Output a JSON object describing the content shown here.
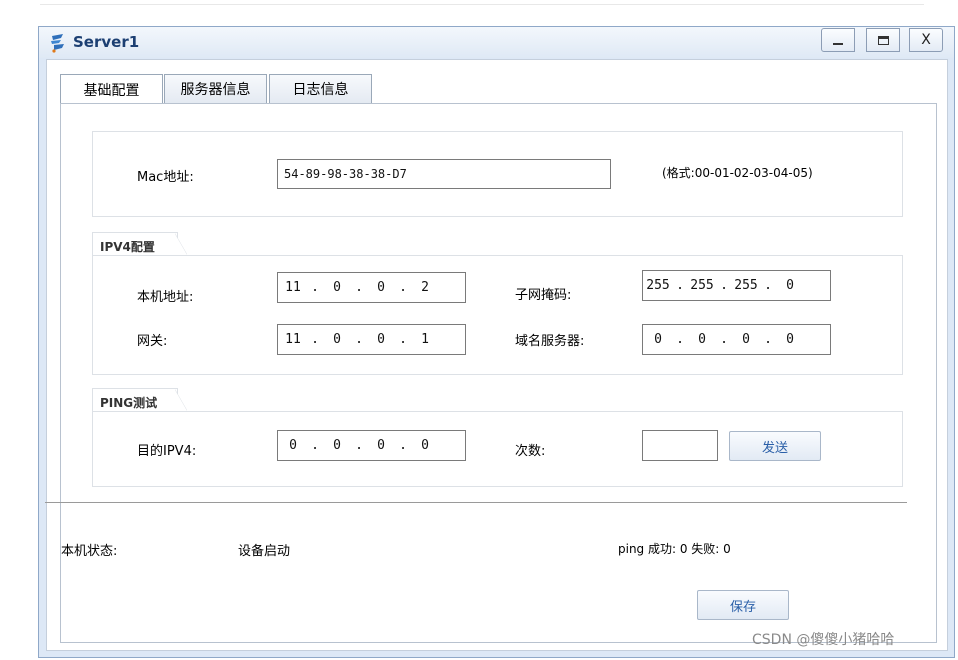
{
  "window": {
    "title": "Server1",
    "minimize_label": "_",
    "maximize_label": "",
    "close_label": "X"
  },
  "tabs": [
    {
      "label": "基础配置",
      "active": true
    },
    {
      "label": "服务器信息",
      "active": false
    },
    {
      "label": "日志信息",
      "active": false
    }
  ],
  "mac": {
    "label": "Mac地址:",
    "value": "54-89-98-38-38-D7",
    "hint": "(格式:00-01-02-03-04-05)"
  },
  "ipv4": {
    "group_title": "IPV4配置",
    "local_address_label": "本机地址:",
    "local_address": [
      "11",
      "0",
      "0",
      "2"
    ],
    "subnet_mask_label": "子网掩码:",
    "subnet_mask": [
      "255",
      "255",
      "255",
      "0"
    ],
    "gateway_label": "网关:",
    "gateway": [
      "11",
      "0",
      "0",
      "1"
    ],
    "dns_label": "域名服务器:",
    "dns": [
      "0",
      "0",
      "0",
      "0"
    ]
  },
  "ping": {
    "group_title": "PING测试",
    "dest_label": "目的IPV4:",
    "dest": [
      "0",
      "0",
      "0",
      "0"
    ],
    "count_label": "次数:",
    "count_value": "",
    "send_label": "发送"
  },
  "status": {
    "label": "本机状态:",
    "value": "设备启动",
    "ping_result": "ping 成功: 0 失败: 0"
  },
  "save_label": "保存",
  "watermark": "CSDN @傻傻小猪哈哈",
  "colors": {
    "title": "#1c3f72",
    "button_text": "#2a5fa8",
    "window_border": "#8fa8c8"
  }
}
